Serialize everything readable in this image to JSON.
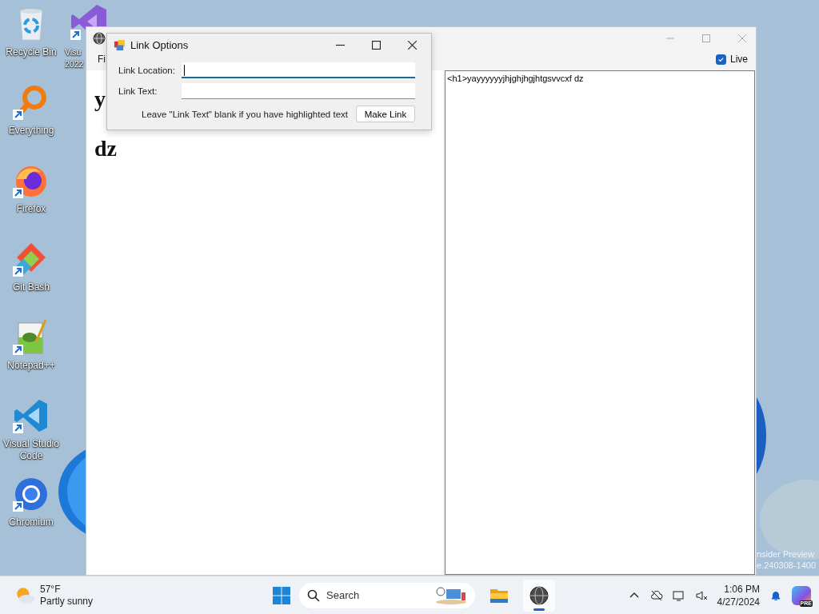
{
  "desktop": {
    "icons": [
      {
        "kind": "recycle",
        "label": "Recycle Bin",
        "shortcut": false
      },
      {
        "kind": "everything",
        "label": "Everything",
        "shortcut": true
      },
      {
        "kind": "firefox",
        "label": "Firefox",
        "shortcut": true
      },
      {
        "kind": "gitbash",
        "label": "Git Bash",
        "shortcut": true
      },
      {
        "kind": "notepadpp",
        "label": "Notepad++",
        "shortcut": true
      },
      {
        "kind": "vscode",
        "label": "Visual Studio Code",
        "shortcut": true
      },
      {
        "kind": "chromium",
        "label": "Chromium",
        "shortcut": true
      }
    ],
    "covered_icon": {
      "kind": "visualstudio",
      "label": "Visu 2022",
      "shortcut": true
    },
    "watermark": [
      "nsider Preview",
      "e.240308-1400"
    ]
  },
  "main_window": {
    "menu": [
      "Fi"
    ],
    "live": {
      "label": "Live",
      "checked": true
    },
    "preview_lines": [
      "y",
      "dz"
    ],
    "source_text": "<h1>yayyyyyyjhjghjhgjhtgsvvcxf dz"
  },
  "dialog": {
    "title": "Link Options",
    "fields": [
      {
        "label": "Link Location:",
        "focused": true
      },
      {
        "label": "Link Text:",
        "focused": false
      }
    ],
    "hint": "Leave \"Link Text\" blank if you have highlighted text",
    "button": "Make Link"
  },
  "taskbar": {
    "weather": {
      "temperature": "57°F",
      "condition": "Partly sunny"
    },
    "search": {
      "placeholder": "Search"
    },
    "apps": [
      {
        "kind": "explorer",
        "selected": false
      },
      {
        "kind": "app",
        "selected": true
      }
    ],
    "badge": "PRE",
    "time": "1:06 PM",
    "date": "4/27/2024"
  }
}
